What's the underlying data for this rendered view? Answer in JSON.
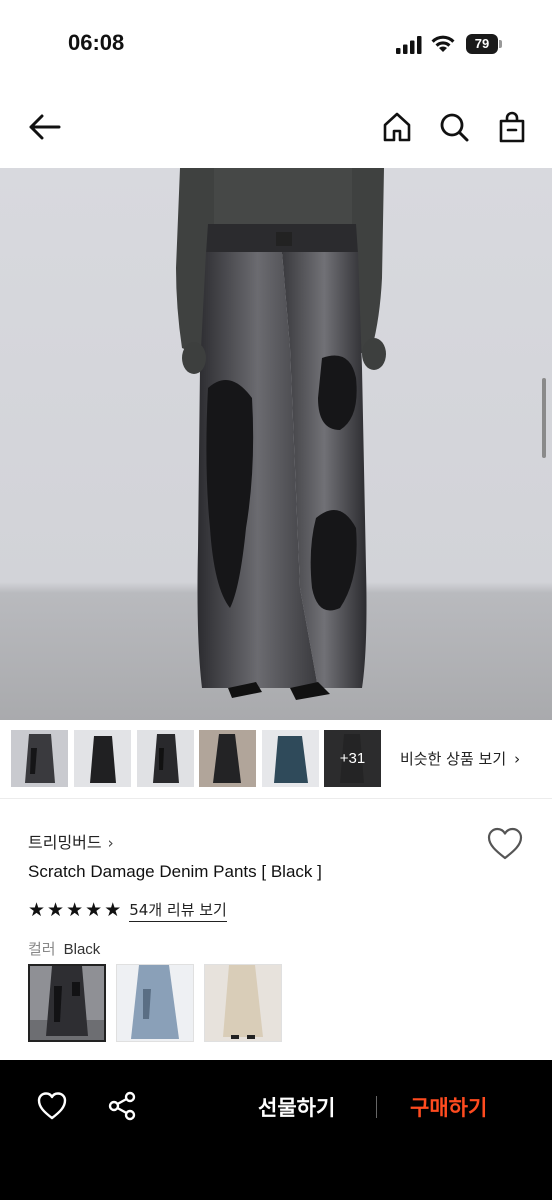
{
  "status_bar": {
    "time": "06:08",
    "battery_level": "79",
    "icons": [
      "signal-icon",
      "wifi-icon",
      "battery-icon"
    ]
  },
  "nav": {
    "icons": [
      "back-arrow-icon",
      "home-icon",
      "search-icon",
      "shopping-bag-icon"
    ]
  },
  "thumbnails": {
    "more_count": "+31",
    "similar_label": "비슷한 상품 보기",
    "similar_chevron": "›"
  },
  "product": {
    "brand": "트리밍버드",
    "brand_chevron": "›",
    "name": "Scratch Damage Denim Pants [ Black ]",
    "rating_stars": 5,
    "review_link": "54개 리뷰 보기",
    "option_label": "컬러",
    "option_value": "Black",
    "swatch_count": 3
  },
  "bottom_bar": {
    "gift_label": "선물하기",
    "buy_label": "구매하기",
    "icons": [
      "heart-icon",
      "share-icon"
    ]
  },
  "colors": {
    "buy_accent": "#ff4b1f",
    "bottom_bar_bg": "#000000"
  }
}
